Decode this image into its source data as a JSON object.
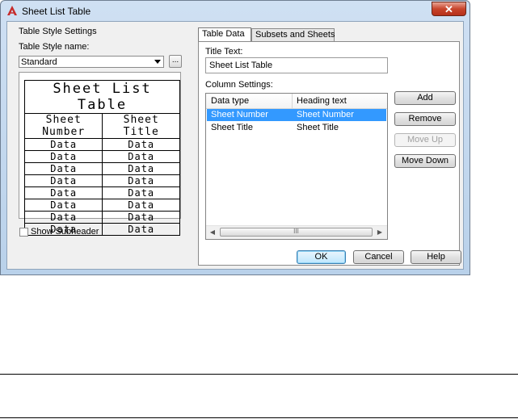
{
  "window": {
    "title": "Sheet List Table",
    "close_label": "✕"
  },
  "left": {
    "section_label": "Table Style Settings",
    "style_name_label": "Table Style name:",
    "style_name_value": "Standard",
    "browse_label": "...",
    "preview": {
      "caption": "Sheet List Table",
      "headers": [
        "Sheet Number",
        "Sheet Title"
      ],
      "cell": "Data",
      "rows": 8
    },
    "show_subheader_label": "Show Subheader",
    "show_subheader_checked": false
  },
  "tabs": [
    {
      "label": "Table Data",
      "active": true
    },
    {
      "label": "Subsets and Sheets",
      "active": false
    }
  ],
  "table_data": {
    "title_text_label": "Title Text:",
    "title_text_value": "Sheet List Table",
    "column_settings_label": "Column Settings:",
    "columns": [
      "Data type",
      "Heading text"
    ],
    "rows": [
      {
        "data_type": "Sheet Number",
        "heading": "Sheet Number",
        "selected": true
      },
      {
        "data_type": "Sheet Title",
        "heading": "Sheet Title",
        "selected": false
      }
    ],
    "scroll_grip": "III",
    "buttons": {
      "add": "Add",
      "remove": "Remove",
      "move_up": "Move Up",
      "move_down": "Move Down"
    }
  },
  "footer": {
    "ok": "OK",
    "cancel": "Cancel",
    "help": "Help"
  },
  "colors": {
    "selection": "#3399ff",
    "close": "#c8452c"
  }
}
